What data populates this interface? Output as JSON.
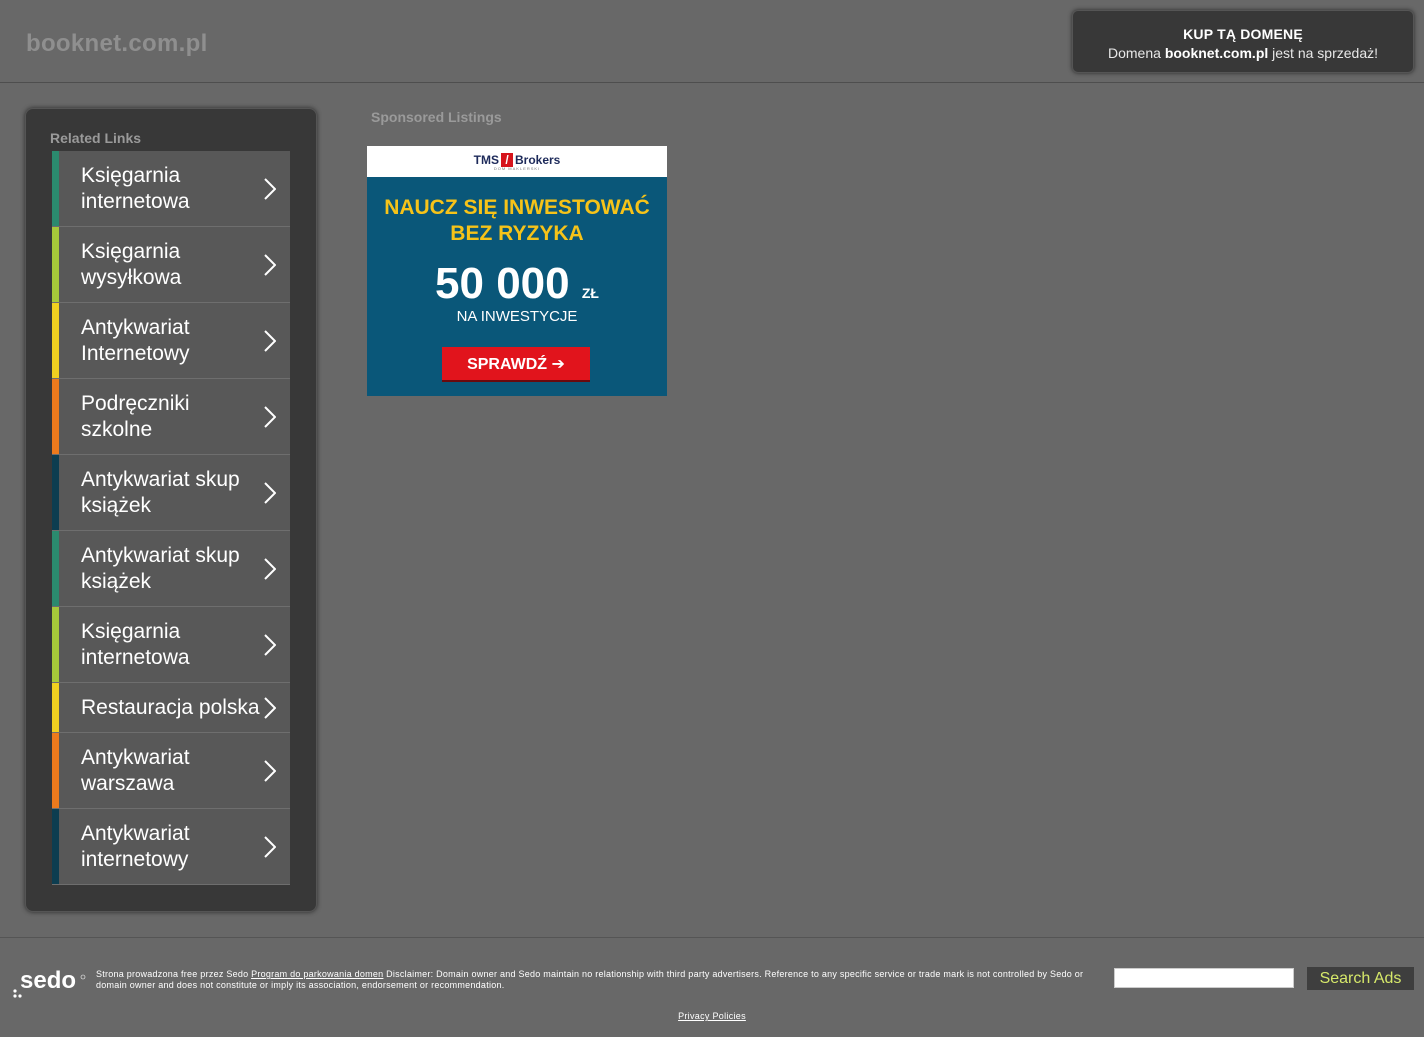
{
  "header": {
    "domain": "booknet.com.pl",
    "buy_title": "KUP TĄ DOMENĘ",
    "buy_prefix": "Domena ",
    "buy_domain": "booknet.com.pl",
    "buy_suffix": " jest na sprzedaż!"
  },
  "sidebar": {
    "title": "Related Links",
    "links": [
      {
        "label": "Księgarnia internetowa",
        "color": "#2b8a6e"
      },
      {
        "label": "Księgarnia wysyłkowa",
        "color": "#a6c93a"
      },
      {
        "label": "Antykwariat Internetowy",
        "color": "#f0d020"
      },
      {
        "label": "Podręczniki szkolne",
        "color": "#ec7a1d"
      },
      {
        "label": "Antykwariat skup książek",
        "color": "#0d3d50"
      },
      {
        "label": "Antykwariat skup książek",
        "color": "#2b8a6e"
      },
      {
        "label": "Księgarnia internetowa",
        "color": "#a6c93a"
      },
      {
        "label": "Restauracja polska",
        "color": "#f0d020"
      },
      {
        "label": "Antykwariat warszawa",
        "color": "#ec7a1d"
      },
      {
        "label": "Antykwariat internetowy",
        "color": "#0d3d50"
      }
    ]
  },
  "sponsored": {
    "title": "Sponsored Listings",
    "ad": {
      "brand_left": "TMS",
      "brand_right": "Brokers",
      "brand_sub": "DOM MAKLERSKI",
      "headline_1": "NAUCZ SIĘ INWESTOWAĆ",
      "headline_2": "BEZ RYZYKA",
      "amount": "50 000",
      "currency": "ZŁ",
      "subline": "NA INWESTYCJE",
      "cta": "SPRAWDŹ"
    }
  },
  "footer": {
    "logo_text": "sedo",
    "text_prefix": "Strona prowadzona free przez Sedo ",
    "program_link": "Program do parkowania domen",
    "disclaimer": " Disclaimer: Domain owner and Sedo maintain no relationship with third party advertisers. Reference to any specific service or trade mark is not controlled by Sedo or domain owner and does not constitute or imply its association, endorsement or recommendation.",
    "search_placeholder": "",
    "search_button": "Search Ads",
    "privacy": "Privacy Policies"
  },
  "colors": {
    "background": "#686868",
    "panel": "#383838",
    "search_button_text": "#d6e86a"
  }
}
